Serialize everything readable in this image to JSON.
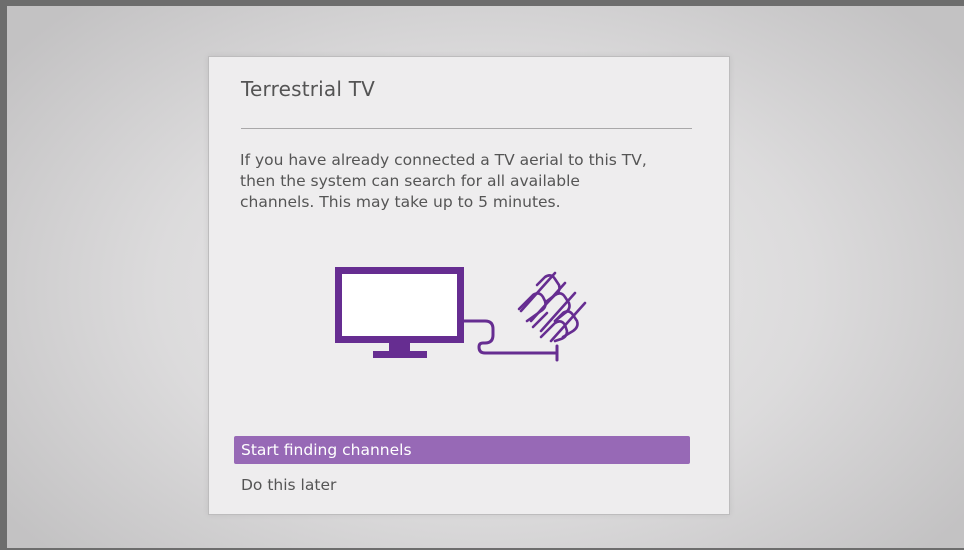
{
  "dialog": {
    "title": "Terrestrial TV",
    "description": "If you have already connected a TV aerial to this TV,\nthen the system can search for all available\nchannels. This may take up to 5 minutes.",
    "illustration_icons": [
      "tv-icon",
      "aerial-icon"
    ],
    "actions": [
      {
        "label": "Start finding channels",
        "selected": true
      },
      {
        "label": "Do this later",
        "selected": false
      }
    ]
  },
  "colors": {
    "accent": "#9769b6",
    "illustration": "#662d91",
    "dialog_bg": "#eeedee",
    "text": "#555555",
    "frame": "#6d6d6d"
  }
}
